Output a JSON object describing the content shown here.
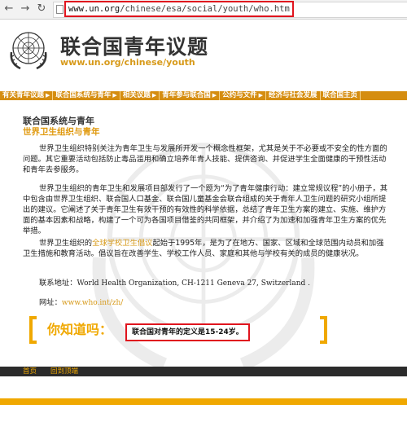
{
  "browser": {
    "url_host": "www.un.org",
    "url_path": "/chinese/esa/social/youth/who.htm"
  },
  "header": {
    "title": "联合国青年议题",
    "url": "www.un.org/chinese/youth"
  },
  "nav": {
    "items": [
      {
        "label": "有关青年议题",
        "arrow": "▶"
      },
      {
        "label": "联合国系统与青年",
        "arrow": "▶"
      },
      {
        "label": "相关议题",
        "arrow": "▶"
      },
      {
        "label": "青年参与联合国",
        "arrow": "▶"
      },
      {
        "label": "公约与文件",
        "arrow": "▶"
      },
      {
        "label": "经济与社会发展",
        "arrow": ""
      },
      {
        "label": "联合国主页",
        "arrow": ""
      }
    ]
  },
  "main": {
    "section_title": "联合国系统与青年",
    "section_subtitle": "世界卫生组织与青年",
    "para1": "世界卫生组织特别关注为青年卫生与发展所开发一个概念性框架，尤其是关于不必要或不安全的性方面的问题。其它重要活动包括防止毒品滥用和确立培养年青人技能、提供咨询、并促进学生全面健康的干预性活动和青年去参服务。",
    "para2": "世界卫生组织的青年卫生和发展项目部发行了一个题为“为了青年健康行动：建立常规议程”的小册子，其中包含由世界卫生组织、联合国人口基金、联合国儿童基金会联合组成的关于青年人卫生问题的研究小组所提出的建议。它阐述了关于青年卫生有效干预的有效性的科学依据，总结了青年卫生方案的建立、实施、维护方面的基本因素和战略，构建了一个可为各国项目借鉴的共同框架，并介绍了为加速和加强青年卫生方案的优先举措。",
    "para3_prefix": "世界卫生组织的",
    "para3_link": "全球学校卫生倡议",
    "para3_suffix": "起始于1995年，是为了在地方、国家、区域和全球范围内动员和加强卫生措施和教育活动。倡议旨在改善学生、学校工作人员、家庭和其他与学校有关的成员的健康状况。",
    "contact_label": "联系地址：",
    "contact_address": "World Health Organization, CH-1211 Geneva 27, Switzerland .",
    "website_label": "网址：",
    "website_url": "www.who.int/zh/"
  },
  "did_you_know": {
    "label": "你知道吗：",
    "fact": "联合国对青年的定义是15-24岁。"
  },
  "footer": {
    "home": "首页",
    "back_to_top": "回到顶端"
  },
  "colors": {
    "accent": "#f0a800",
    "nav_bg": "#d58d10",
    "highlight_border": "#e0141e"
  }
}
